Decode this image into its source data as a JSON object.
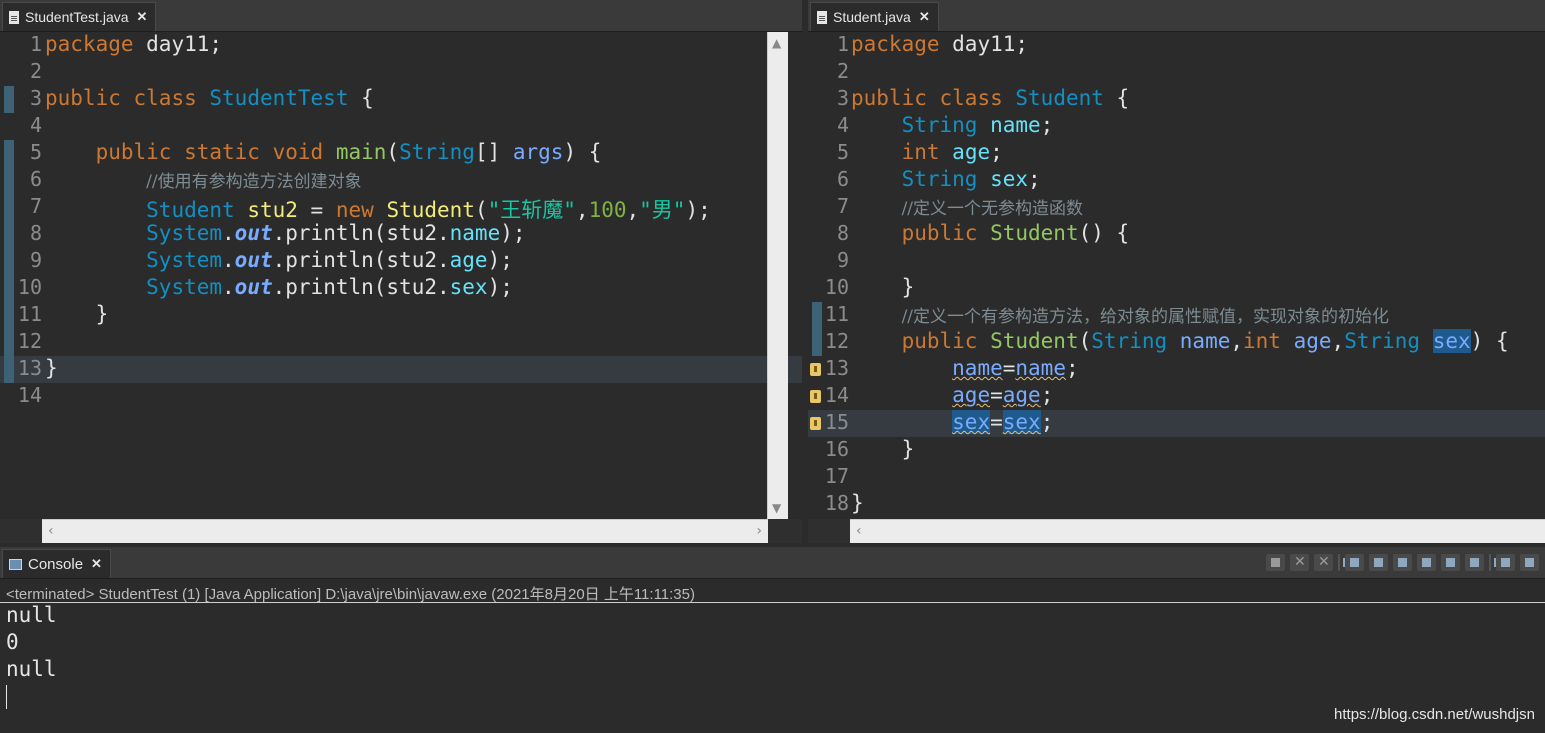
{
  "left_editor": {
    "tab_title": "StudentTest.java",
    "close_glyph": "✕",
    "lines": [
      {
        "n": "1",
        "tokens": [
          {
            "c": "kw",
            "t": "package"
          },
          {
            "c": "plain",
            "t": " day11;"
          }
        ]
      },
      {
        "n": "2",
        "tokens": []
      },
      {
        "n": "3",
        "tokens": [
          {
            "c": "kw",
            "t": "public"
          },
          {
            "c": "plain",
            "t": " "
          },
          {
            "c": "kw",
            "t": "class"
          },
          {
            "c": "plain",
            "t": " "
          },
          {
            "c": "type",
            "t": "StudentTest"
          },
          {
            "c": "plain",
            "t": " {"
          }
        ]
      },
      {
        "n": "4",
        "tokens": []
      },
      {
        "n": "5",
        "tokens": [
          {
            "c": "plain",
            "t": "    "
          },
          {
            "c": "kw",
            "t": "public"
          },
          {
            "c": "plain",
            "t": " "
          },
          {
            "c": "kw",
            "t": "static"
          },
          {
            "c": "plain",
            "t": " "
          },
          {
            "c": "kw",
            "t": "void"
          },
          {
            "c": "plain",
            "t": " "
          },
          {
            "c": "fn",
            "t": "main"
          },
          {
            "c": "plain",
            "t": "("
          },
          {
            "c": "type",
            "t": "String"
          },
          {
            "c": "plain",
            "t": "[] "
          },
          {
            "c": "var",
            "t": "args"
          },
          {
            "c": "plain",
            "t": ") {"
          }
        ]
      },
      {
        "n": "6",
        "tokens": [
          {
            "c": "plain",
            "t": "        "
          },
          {
            "c": "comment",
            "t": "//使用有参构造方法创建对象"
          }
        ]
      },
      {
        "n": "7",
        "tokens": [
          {
            "c": "plain",
            "t": "        "
          },
          {
            "c": "type",
            "t": "Student"
          },
          {
            "c": "plain",
            "t": " "
          },
          {
            "c": "local",
            "t": "stu2"
          },
          {
            "c": "plain",
            "t": " = "
          },
          {
            "c": "kw",
            "t": "new"
          },
          {
            "c": "plain",
            "t": " "
          },
          {
            "c": "local",
            "t": "Student"
          },
          {
            "c": "plain",
            "t": "("
          },
          {
            "c": "str",
            "t": "\"王斩魔\""
          },
          {
            "c": "plain",
            "t": ","
          },
          {
            "c": "num",
            "t": "100"
          },
          {
            "c": "plain",
            "t": ","
          },
          {
            "c": "str",
            "t": "\"男\""
          },
          {
            "c": "plain",
            "t": ");"
          }
        ]
      },
      {
        "n": "8",
        "tokens": [
          {
            "c": "plain",
            "t": "        "
          },
          {
            "c": "type",
            "t": "System"
          },
          {
            "c": "plain",
            "t": "."
          },
          {
            "c": "static",
            "t": "out"
          },
          {
            "c": "plain",
            "t": "."
          },
          {
            "c": "plain",
            "t": "println(stu2."
          },
          {
            "c": "field",
            "t": "name"
          },
          {
            "c": "plain",
            "t": ");"
          }
        ]
      },
      {
        "n": "9",
        "tokens": [
          {
            "c": "plain",
            "t": "        "
          },
          {
            "c": "type",
            "t": "System"
          },
          {
            "c": "plain",
            "t": "."
          },
          {
            "c": "static",
            "t": "out"
          },
          {
            "c": "plain",
            "t": "."
          },
          {
            "c": "plain",
            "t": "println(stu2."
          },
          {
            "c": "field",
            "t": "age"
          },
          {
            "c": "plain",
            "t": ");"
          }
        ]
      },
      {
        "n": "10",
        "tokens": [
          {
            "c": "plain",
            "t": "        "
          },
          {
            "c": "type",
            "t": "System"
          },
          {
            "c": "plain",
            "t": "."
          },
          {
            "c": "static",
            "t": "out"
          },
          {
            "c": "plain",
            "t": "."
          },
          {
            "c": "plain",
            "t": "println(stu2."
          },
          {
            "c": "field",
            "t": "sex"
          },
          {
            "c": "plain",
            "t": ");"
          }
        ]
      },
      {
        "n": "11",
        "tokens": [
          {
            "c": "plain",
            "t": "    }"
          }
        ]
      },
      {
        "n": "12",
        "tokens": []
      },
      {
        "n": "13",
        "tokens": [
          {
            "c": "plain",
            "t": "}"
          }
        ]
      },
      {
        "n": "14",
        "tokens": []
      }
    ],
    "marked_lines": [
      "3",
      "5",
      "6",
      "7",
      "8",
      "9",
      "10",
      "11",
      "12",
      "13"
    ],
    "current_line": "13"
  },
  "right_editor": {
    "tab_title": "Student.java",
    "close_glyph": "✕",
    "lines": [
      {
        "n": "1",
        "tokens": [
          {
            "c": "kw",
            "t": "package"
          },
          {
            "c": "plain",
            "t": " day11;"
          }
        ]
      },
      {
        "n": "2",
        "tokens": []
      },
      {
        "n": "3",
        "tokens": [
          {
            "c": "kw",
            "t": "public"
          },
          {
            "c": "plain",
            "t": " "
          },
          {
            "c": "kw",
            "t": "class"
          },
          {
            "c": "plain",
            "t": " "
          },
          {
            "c": "type",
            "t": "Student"
          },
          {
            "c": "plain",
            "t": " {"
          }
        ]
      },
      {
        "n": "4",
        "tokens": [
          {
            "c": "plain",
            "t": "    "
          },
          {
            "c": "type",
            "t": "String"
          },
          {
            "c": "plain",
            "t": " "
          },
          {
            "c": "field",
            "t": "name"
          },
          {
            "c": "plain",
            "t": ";"
          }
        ]
      },
      {
        "n": "5",
        "tokens": [
          {
            "c": "plain",
            "t": "    "
          },
          {
            "c": "kw",
            "t": "int"
          },
          {
            "c": "plain",
            "t": " "
          },
          {
            "c": "field",
            "t": "age"
          },
          {
            "c": "plain",
            "t": ";"
          }
        ]
      },
      {
        "n": "6",
        "tokens": [
          {
            "c": "plain",
            "t": "    "
          },
          {
            "c": "type",
            "t": "String"
          },
          {
            "c": "plain",
            "t": " "
          },
          {
            "c": "field",
            "t": "sex"
          },
          {
            "c": "plain",
            "t": ";"
          }
        ]
      },
      {
        "n": "7",
        "tokens": [
          {
            "c": "plain",
            "t": "    "
          },
          {
            "c": "comment",
            "t": "//定义一个无参构造函数"
          }
        ]
      },
      {
        "n": "8",
        "tokens": [
          {
            "c": "plain",
            "t": "    "
          },
          {
            "c": "kw",
            "t": "public"
          },
          {
            "c": "plain",
            "t": " "
          },
          {
            "c": "fn",
            "t": "Student"
          },
          {
            "c": "plain",
            "t": "() {"
          }
        ]
      },
      {
        "n": "9",
        "tokens": []
      },
      {
        "n": "10",
        "tokens": [
          {
            "c": "plain",
            "t": "    }"
          }
        ]
      },
      {
        "n": "11",
        "tokens": [
          {
            "c": "plain",
            "t": "    "
          },
          {
            "c": "comment",
            "t": "//定义一个有参构造方法，给对象的属性赋值，实现对象的初始化"
          }
        ]
      },
      {
        "n": "12",
        "tokens": [
          {
            "c": "plain",
            "t": "    "
          },
          {
            "c": "kw",
            "t": "public"
          },
          {
            "c": "plain",
            "t": " "
          },
          {
            "c": "fn",
            "t": "Student"
          },
          {
            "c": "plain",
            "t": "("
          },
          {
            "c": "type",
            "t": "String"
          },
          {
            "c": "plain",
            "t": " "
          },
          {
            "c": "var",
            "t": "name"
          },
          {
            "c": "plain",
            "t": ","
          },
          {
            "c": "kw",
            "t": "int"
          },
          {
            "c": "plain",
            "t": " "
          },
          {
            "c": "var",
            "t": "age"
          },
          {
            "c": "plain",
            "t": ","
          },
          {
            "c": "type",
            "t": "String"
          },
          {
            "c": "plain",
            "t": " "
          },
          {
            "c": "var hl",
            "t": "sex"
          },
          {
            "c": "plain",
            "t": ") {"
          }
        ]
      },
      {
        "n": "13",
        "tokens": [
          {
            "c": "plain",
            "t": "        "
          },
          {
            "c": "var squig",
            "t": "name"
          },
          {
            "c": "plain",
            "t": "="
          },
          {
            "c": "var squig",
            "t": "name"
          },
          {
            "c": "plain",
            "t": ";"
          }
        ]
      },
      {
        "n": "14",
        "tokens": [
          {
            "c": "plain",
            "t": "        "
          },
          {
            "c": "var squig",
            "t": "age"
          },
          {
            "c": "plain",
            "t": "="
          },
          {
            "c": "var squig",
            "t": "age"
          },
          {
            "c": "plain",
            "t": ";"
          }
        ]
      },
      {
        "n": "15",
        "tokens": [
          {
            "c": "plain",
            "t": "        "
          },
          {
            "c": "var squig hl",
            "t": "sex"
          },
          {
            "c": "plain",
            "t": "="
          },
          {
            "c": "var squig hl",
            "t": "sex"
          },
          {
            "c": "plain",
            "t": ";"
          }
        ]
      },
      {
        "n": "16",
        "tokens": [
          {
            "c": "plain",
            "t": "    }"
          }
        ]
      },
      {
        "n": "17",
        "tokens": []
      },
      {
        "n": "18",
        "tokens": [
          {
            "c": "plain",
            "t": "}"
          }
        ]
      }
    ],
    "marked_lines": [
      "11",
      "12"
    ],
    "warning_lines": [
      "13",
      "14",
      "15"
    ],
    "current_line": "15"
  },
  "console": {
    "tab_title": "Console",
    "close_glyph": "✕",
    "status": "<terminated> StudentTest (1) [Java Application] D:\\java\\jre\\bin\\javaw.exe (2021年8月20日 上午11:11:35)",
    "output": [
      "null",
      "0",
      "null"
    ],
    "toolbar": [
      "terminate-icon",
      "remove-launch-icon",
      "remove-all-terminated-icon",
      "clear-console-icon",
      "scroll-lock-icon",
      "word-wrap-icon",
      "show-on-output-icon",
      "show-on-error-icon",
      "pin-console-icon",
      "display-selected-console-icon",
      "open-console-icon"
    ]
  },
  "watermark": "https://blog.csdn.net/wushdjsn",
  "colors": {
    "background": "#2b2b2b",
    "keyword": "#cc7832",
    "type": "#1290c3",
    "method": "#93c763",
    "parameter": "#79abff",
    "field": "#66e1f8",
    "string": "#17c6a3",
    "comment": "#7d8c93"
  }
}
